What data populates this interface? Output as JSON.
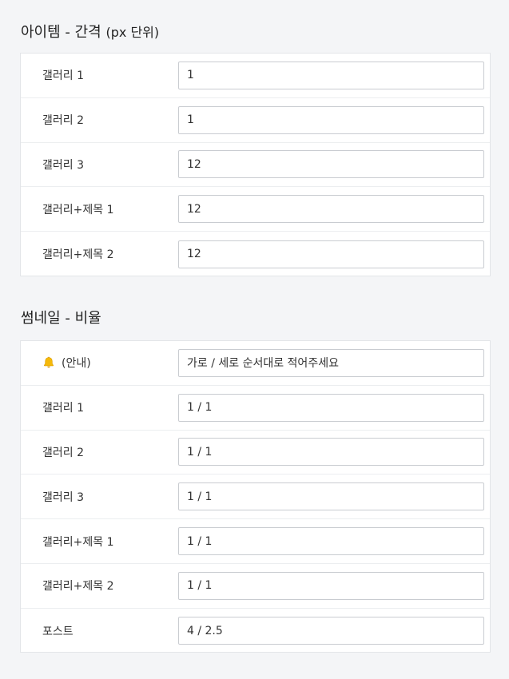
{
  "spacing_section": {
    "title_main": "아이템 - 간격",
    "title_unit": "(px 단위)",
    "rows": [
      {
        "label": "갤러리 1",
        "value": "1"
      },
      {
        "label": "갤러리 2",
        "value": "1"
      },
      {
        "label": "갤러리 3",
        "value": "12"
      },
      {
        "label": "갤러리+제목 1",
        "value": "12"
      },
      {
        "label": "갤러리+제목 2",
        "value": "12"
      }
    ]
  },
  "ratio_section": {
    "title": "썸네일 - 비율",
    "notice": {
      "label": "(안내)",
      "value": "가로 / 세로 순서대로 적어주세요",
      "icon": "bell-icon"
    },
    "rows": [
      {
        "label": "갤러리 1",
        "value": "1 / 1"
      },
      {
        "label": "갤러리 2",
        "value": "1 / 1"
      },
      {
        "label": "갤러리 3",
        "value": "1 / 1"
      },
      {
        "label": "갤러리+제목 1",
        "value": "1 / 1"
      },
      {
        "label": "갤러리+제목 2",
        "value": "1 / 1"
      },
      {
        "label": "포스트",
        "value": "4 / 2.5"
      }
    ]
  }
}
